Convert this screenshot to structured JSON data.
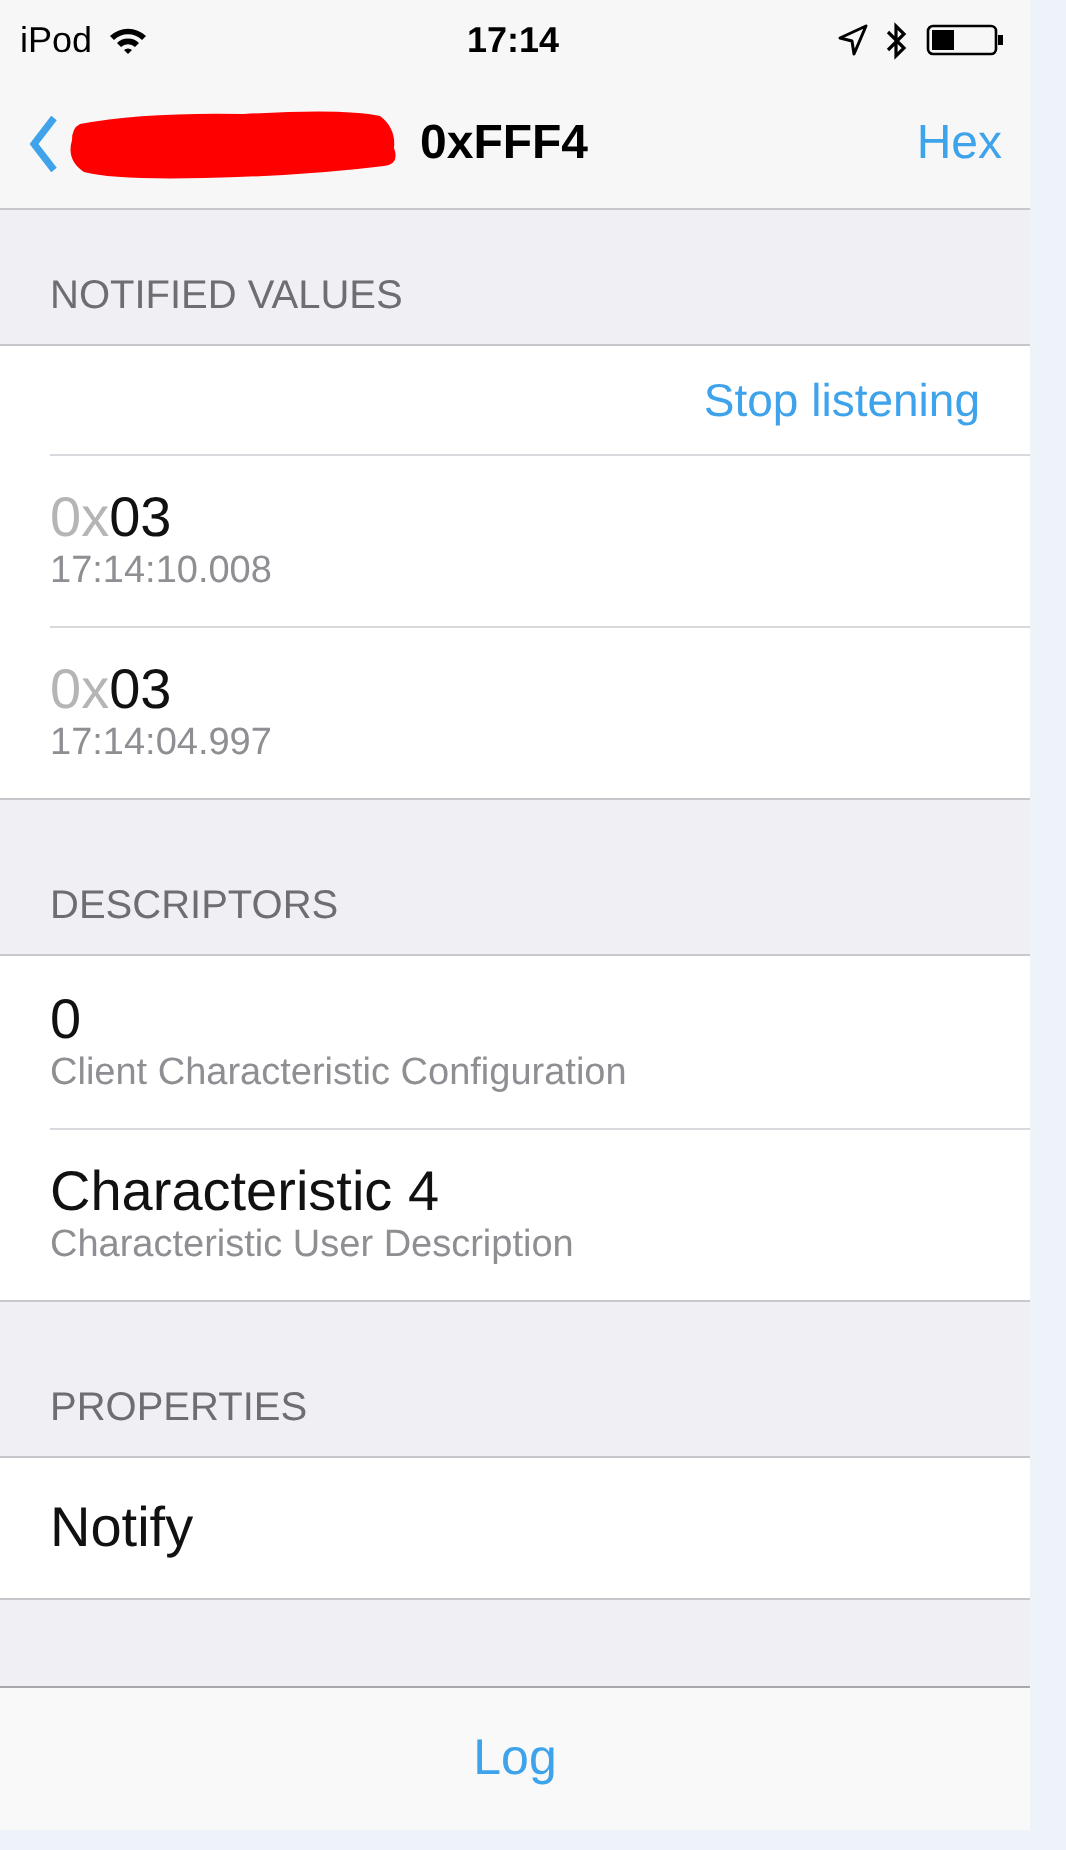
{
  "status_bar": {
    "carrier": "iPod",
    "time": "17:14"
  },
  "nav_bar": {
    "title": "0xFFF4",
    "right_button": "Hex"
  },
  "sections": [
    {
      "header": "NOTIFIED VALUES",
      "rows": [
        {
          "kind": "action",
          "label": "Stop listening"
        },
        {
          "kind": "value",
          "prefix": "0x",
          "value": "03",
          "subtitle": "17:14:10.008"
        },
        {
          "kind": "value",
          "prefix": "0x",
          "value": "03",
          "subtitle": "17:14:04.997"
        }
      ]
    },
    {
      "header": "DESCRIPTORS",
      "rows": [
        {
          "kind": "detail",
          "title": "0",
          "subtitle": "Client Characteristic Configuration"
        },
        {
          "kind": "detail",
          "title": "Characteristic 4",
          "subtitle": "Characteristic User Description"
        }
      ]
    },
    {
      "header": "PROPERTIES",
      "rows": [
        {
          "kind": "plain",
          "title": "Notify"
        }
      ]
    }
  ],
  "toolbar": {
    "button": "Log"
  }
}
